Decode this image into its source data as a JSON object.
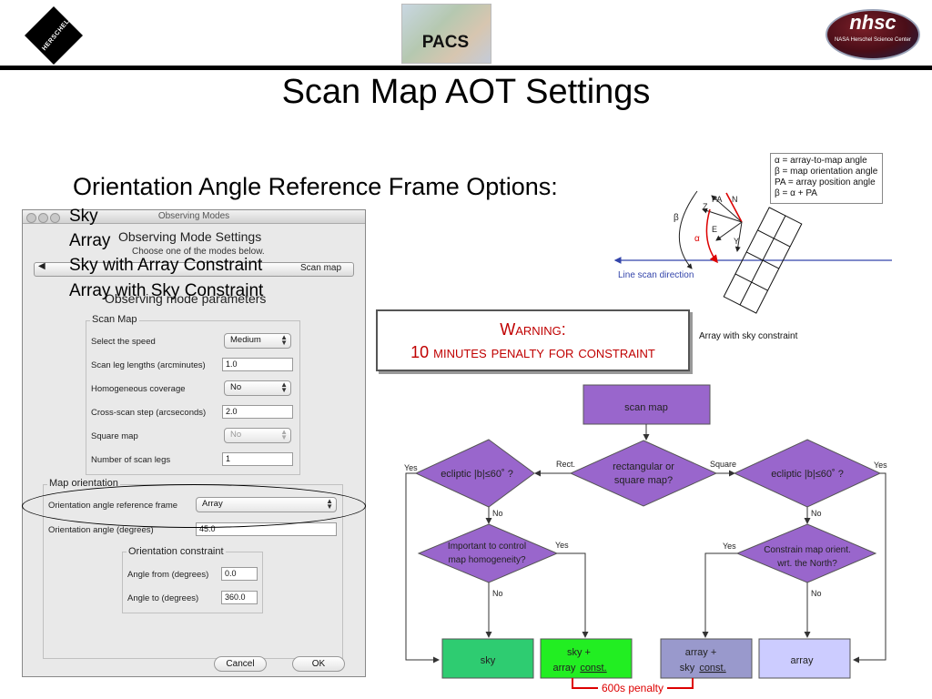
{
  "header": {
    "left_logo_text": "HERSCHEL",
    "center_logo_text": "PACS",
    "right_logo_text": "nhsc",
    "right_logo_sub": "NASA Herschel Science Center"
  },
  "title": "Scan Map AOT Settings",
  "options": {
    "heading": "Orientation Angle Reference Frame Options:",
    "items": [
      "Sky",
      "Array",
      "Sky with Array Constraint",
      "Array with Sky Constraint"
    ]
  },
  "dialog": {
    "window_title": "Observing Modes",
    "heading": "Observing Mode Settings",
    "subtitle": "Choose one of the modes below.",
    "back_glyph": "◀",
    "mode": "Scan map",
    "params_heading": "Observing mode parameters",
    "scan_group": {
      "title": "Scan Map",
      "rows": [
        {
          "label": "Select the speed",
          "value": "Medium",
          "kind": "select"
        },
        {
          "label": "Scan leg lengths (arcminutes)",
          "value": "1.0",
          "kind": "input"
        },
        {
          "label": "Homogeneous coverage",
          "value": "No",
          "kind": "select"
        },
        {
          "label": "Cross-scan step (arcseconds)",
          "value": "2.0",
          "kind": "input"
        },
        {
          "label": "Square map",
          "value": "No",
          "kind": "select-disabled"
        },
        {
          "label": "Number of scan legs",
          "value": "1",
          "kind": "input"
        }
      ]
    },
    "orientation_group": {
      "title": "Map orientation",
      "frame_label": "Orientation angle reference frame",
      "frame_value": "Array",
      "angle_label": "Orientation angle (degrees)",
      "angle_value": "45.0"
    },
    "constraint_group": {
      "title": "Orientation constraint",
      "from_label": "Angle from (degrees)",
      "from_value": "0.0",
      "to_label": "Angle to (degrees)",
      "to_value": "360.0"
    },
    "cancel_label": "Cancel",
    "ok_label": "OK"
  },
  "warning": {
    "title": "Warning:",
    "text": "10 minutes penalty for constraint"
  },
  "legend": {
    "lines": [
      "α = array-to-map angle",
      "β = map orientation angle",
      "PA = array position angle",
      "β = α + PA"
    ]
  },
  "geometry_diagram": {
    "line_scan_label": "Line scan direction",
    "caption": "Array with sky constraint",
    "beta": "β",
    "alpha": "α",
    "pa": "PA",
    "n": "N",
    "z": "Z",
    "e": "E",
    "y": "Y"
  },
  "flowchart": {
    "colors": {
      "purple": "#9966cc",
      "green_dark": "#2ecc71",
      "green_bright": "#22ee22",
      "lavender_dark": "#9999cc",
      "lavender_light": "#ccccff",
      "red": "#dd0000"
    },
    "start": "scan map",
    "center_q1": "rectangular or",
    "center_q2": "square map?",
    "rect_label": "Rect.",
    "square_label": "Square",
    "left_ecl": "ecliptic |b|≤60˚ ?",
    "right_ecl": "ecliptic |b|≤60˚ ?",
    "left_yes": "Yes",
    "right_yes": "Yes",
    "left_no": "No",
    "right_no": "No",
    "homog_1": "Important to control",
    "homog_2": "map homogeneity?",
    "homog_yes": "Yes",
    "homog_no": "No",
    "north_1": "Constrain map orient.",
    "north_2": "wrt. the North?",
    "north_yes": "Yes",
    "north_no": "No",
    "out_sky": "sky",
    "out_sky_const_1": "sky +",
    "out_sky_const_2a": "array ",
    "out_sky_const_2b": "const.",
    "out_array_const_1": "array +",
    "out_array_const_2a": "sky ",
    "out_array_const_2b": "const.",
    "out_array": "array",
    "penalty": "600s penalty"
  }
}
